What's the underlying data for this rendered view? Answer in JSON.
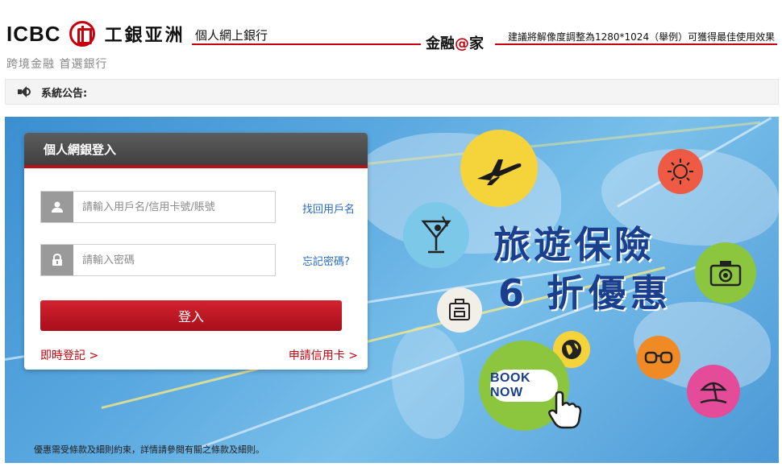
{
  "header": {
    "logo_text": "ICBC",
    "logo_cn": "工銀亚洲",
    "tagline": "跨境金融 首選銀行",
    "section_title": "個人網上銀行",
    "brand_left": "金融",
    "brand_at": "@",
    "brand_right": "家",
    "resolution_note": "建議將解像度調整為1280*1024（舉例）可獲得最佳使用效果"
  },
  "notice": {
    "label": "系統公告:",
    "icon": "speaker-icon"
  },
  "login": {
    "title": "個人網銀登入",
    "username_placeholder": "請輸入用戶名/信用卡號/賬號",
    "password_placeholder": "請輸入密碼",
    "forgot_username": "找回用戶名",
    "forgot_password": "忘記密碼?",
    "submit_label": "登入",
    "register_link": "即時登記 >",
    "apply_card_link": "申請信用卡 >",
    "user_icon": "user-icon",
    "lock_icon": "lock-icon"
  },
  "promo": {
    "headline_line1": "旅遊保險",
    "headline_line2": "6 折優惠",
    "cta": "BOOK NOW",
    "disclaimer": "優惠需受條款及細則約束，詳情請參閱有關之條款及細則。",
    "icons": [
      "airplane-icon",
      "sun-icon",
      "cocktail-icon",
      "camera-icon",
      "suitcase-icon",
      "globe-icon",
      "sunglasses-icon",
      "beach-umbrella-icon",
      "hand-pointer-icon"
    ]
  },
  "colors": {
    "brand_red": "#c7000b",
    "headline_blue": "#1a3f8c",
    "link_blue": "#2a6bbd",
    "button_red": "#b5121b"
  }
}
